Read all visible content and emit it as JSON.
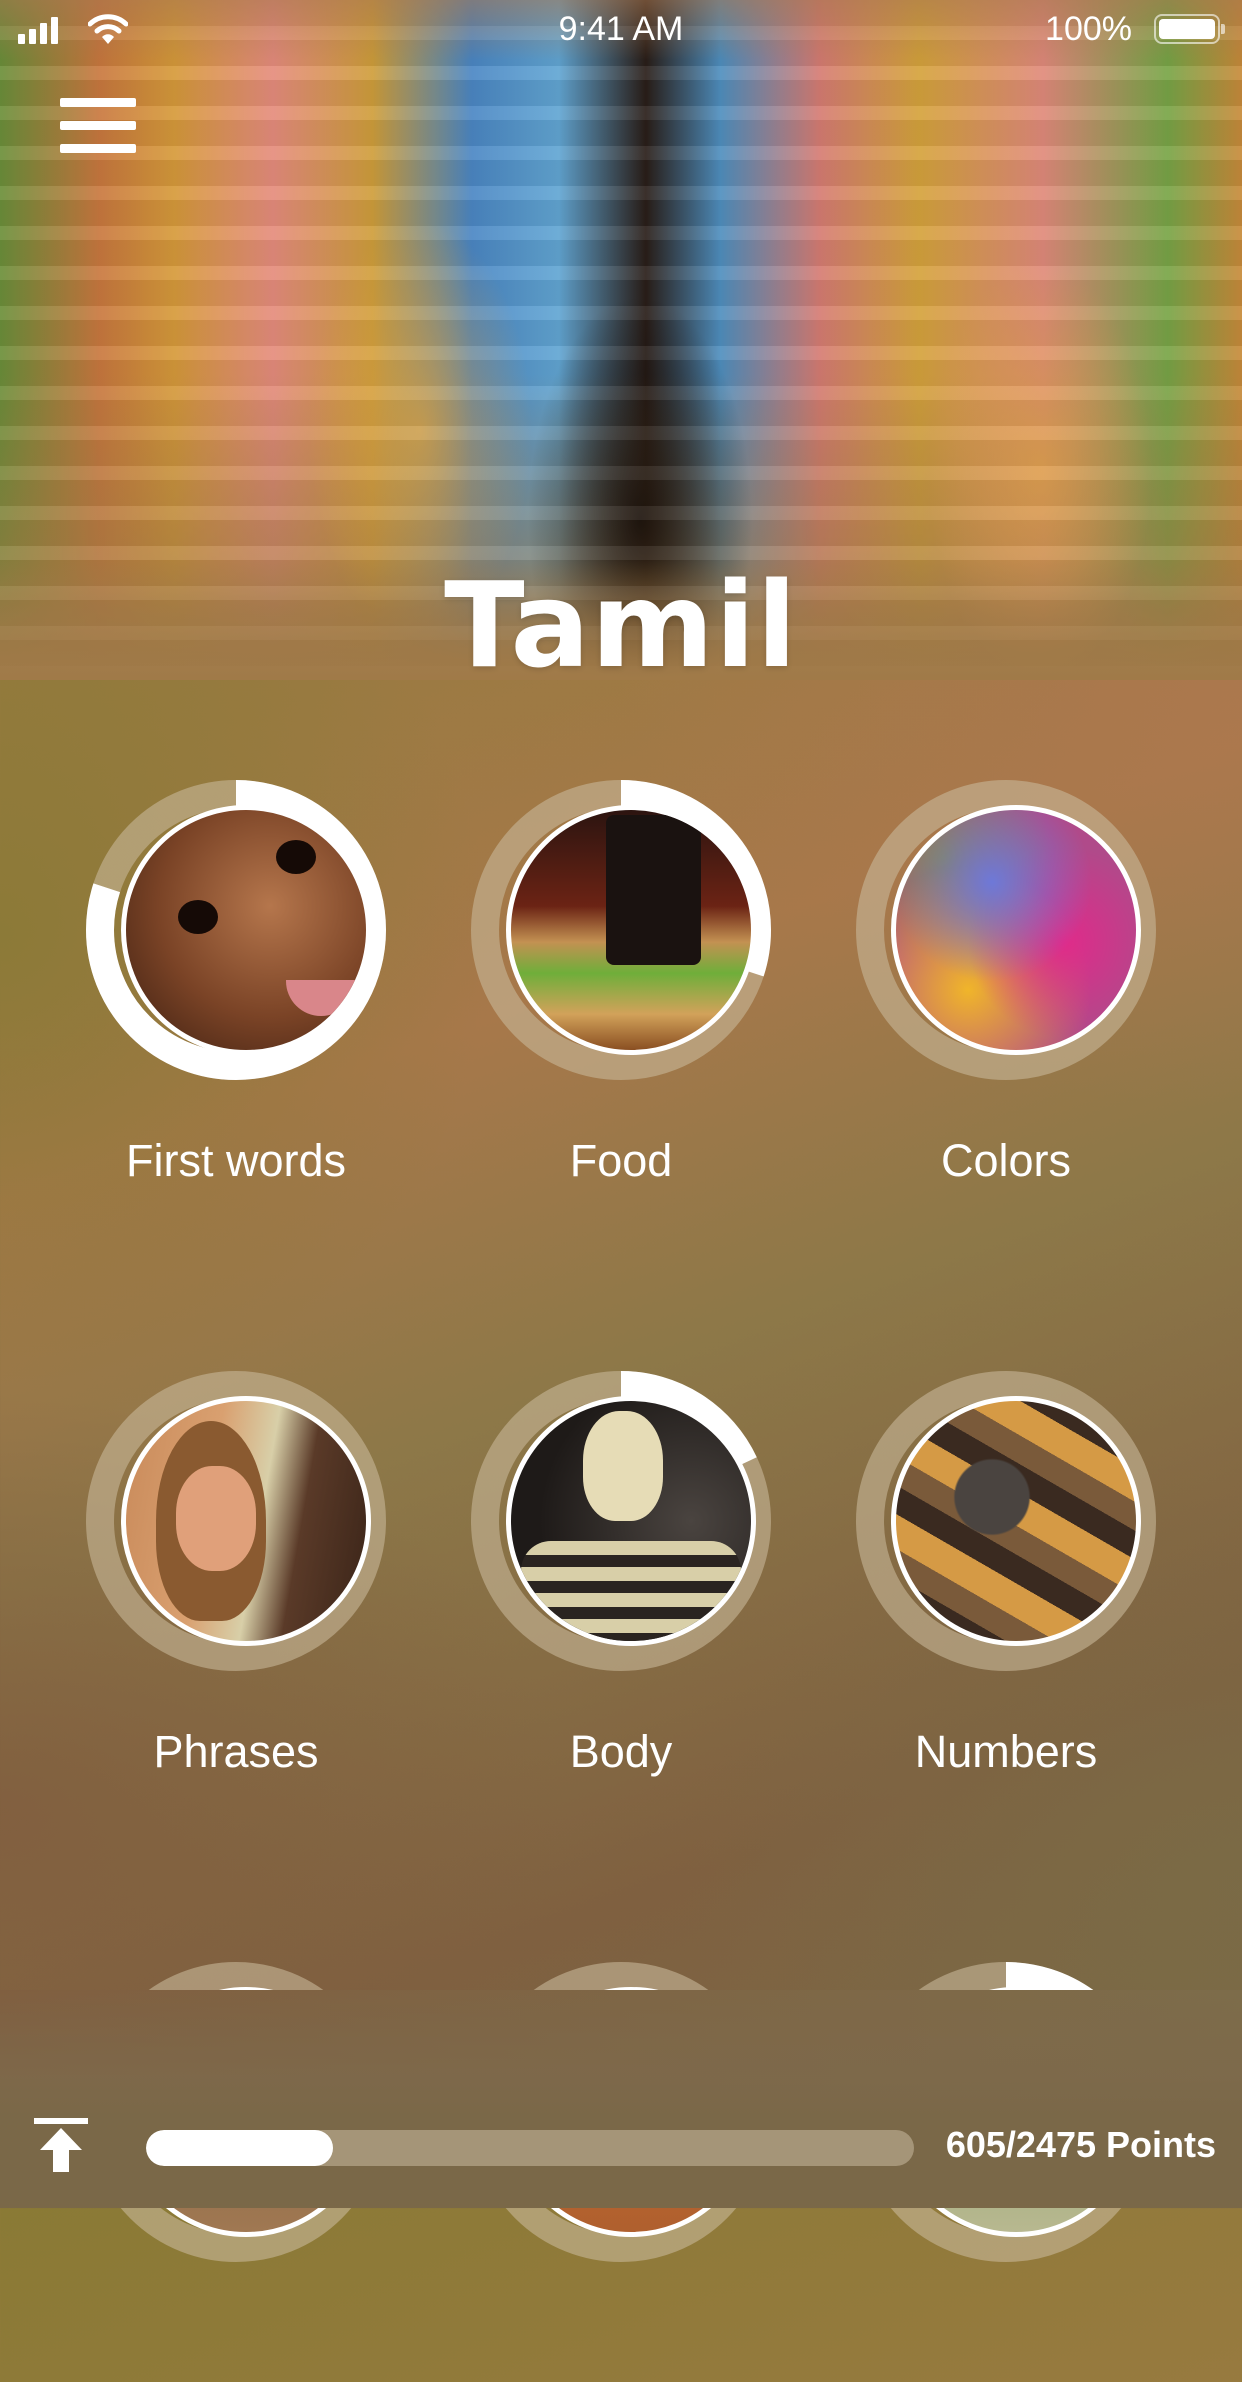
{
  "status_bar": {
    "time": "9:41 AM",
    "battery_percent": "100%",
    "signal_icon": "cellular-signal-icon",
    "wifi_icon": "wifi-icon",
    "battery_icon": "battery-icon"
  },
  "header": {
    "menu_icon": "hamburger-menu-icon",
    "title": "Tamil",
    "hero_image": "temple-sculptures-photo"
  },
  "categories": [
    {
      "label": "First words",
      "progress": 0.8,
      "image": "baby-face-photo"
    },
    {
      "label": "Food",
      "progress": 0.3,
      "image": "burger-and-soda-photo"
    },
    {
      "label": "Colors",
      "progress": 0.0,
      "image": "color-powder-photo"
    },
    {
      "label": "Phrases",
      "progress": 0.0,
      "image": "smiling-woman-photo"
    },
    {
      "label": "Body",
      "progress": 0.18,
      "image": "skeleton-photo"
    },
    {
      "label": "Numbers",
      "progress": 0.0,
      "image": "wooden-numbers-photo"
    },
    {
      "label": "",
      "progress": 0.0,
      "image": "headphones-photo"
    },
    {
      "label": "",
      "progress": 0.0,
      "image": "kitchen-photo"
    },
    {
      "label": "",
      "progress": 0.2,
      "image": "map-pins-photo"
    }
  ],
  "footer": {
    "upload_icon": "scroll-to-top-icon",
    "points_current": 605,
    "points_total": 2475,
    "points_label": "605/2475 Points",
    "progress": 0.244
  },
  "colors": {
    "ring_track": "#c8b89a",
    "ring_progress": "#ffffff",
    "text": "#ffffff"
  }
}
